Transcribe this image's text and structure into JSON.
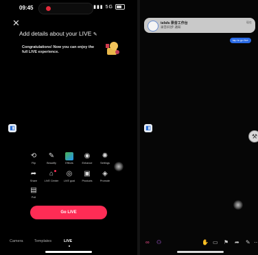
{
  "status_bar": {
    "time": "09:45",
    "network": "5G",
    "battery": "battery-icon"
  },
  "setup": {
    "title": "Add details about your LIVE",
    "promo_text": "Congratulations! Now you can enjoy the full LIVE experience."
  },
  "tools": [
    {
      "label": "Flip",
      "icon": "flip-camera-icon"
    },
    {
      "label": "Beautify",
      "icon": "beautify-icon"
    },
    {
      "label": "Effects",
      "icon": "effects-icon"
    },
    {
      "label": "Enhance",
      "icon": "enhance-icon"
    },
    {
      "label": "Settings",
      "icon": "settings-icon"
    },
    {
      "label": "Share",
      "icon": "share-icon"
    },
    {
      "label": "LIVE Center",
      "icon": "live-center-icon"
    },
    {
      "label": "LIVE goal",
      "icon": "live-goal-icon"
    },
    {
      "label": "Products",
      "icon": "products-icon"
    },
    {
      "label": "Promote",
      "icon": "promote-icon"
    },
    {
      "label": "Poll",
      "icon": "poll-icon"
    }
  ],
  "go_live_label": "Go LIVE",
  "mode_tabs": [
    {
      "label": "Camera",
      "active": false
    },
    {
      "label": "Templates",
      "active": false
    },
    {
      "label": "LIVE",
      "active": true
    }
  ],
  "notification": {
    "title": "tafafa 录音工作台",
    "subtitle": "录音/同步 通知",
    "time": "现在"
  },
  "right_pill": "tap to go live",
  "colors": {
    "accent": "#fe2c55",
    "background": "#000000",
    "notification_bg": "#c9c9c9",
    "pill": "#2b6be6"
  }
}
